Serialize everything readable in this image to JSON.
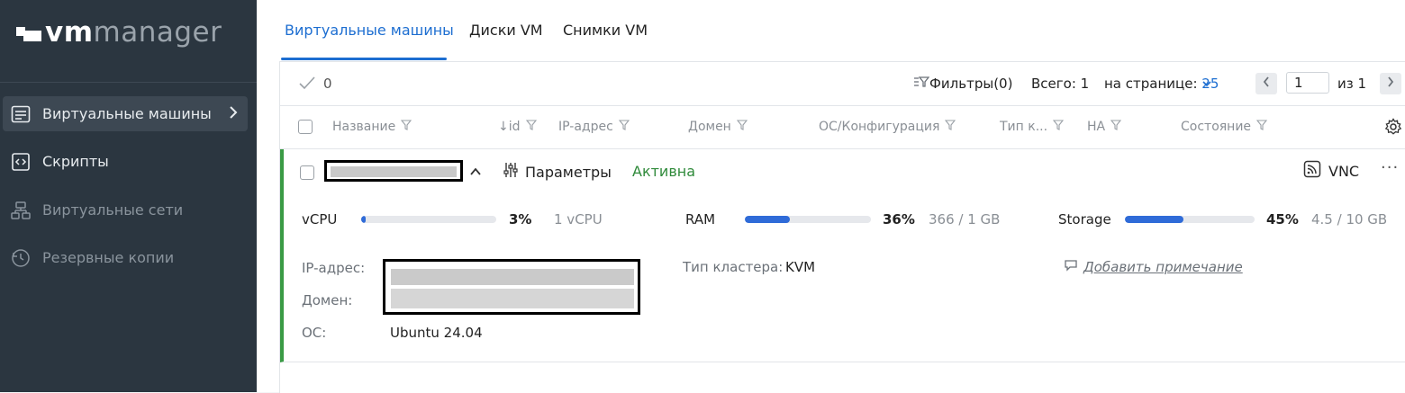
{
  "brand": {
    "vm": "vm",
    "manager": "manager"
  },
  "sidebar": {
    "items": [
      {
        "label": "Виртуальные машины",
        "icon": "vm-list-icon",
        "active": true
      },
      {
        "label": "Скрипты",
        "icon": "script-icon"
      },
      {
        "label": "Виртуальные сети",
        "icon": "network-icon"
      },
      {
        "label": "Резервные копии",
        "icon": "backup-icon"
      }
    ]
  },
  "tabs": [
    {
      "label": "Виртуальные машины"
    },
    {
      "label": "Диски VM"
    },
    {
      "label": "Снимки VM"
    }
  ],
  "toolbar": {
    "selected_count": "0",
    "filters": "Фильтры(0)",
    "total": "Всего: 1",
    "per_page_label": "на странице:",
    "per_page_value": "25",
    "page": "1",
    "of": "из 1"
  },
  "columns": [
    {
      "label": "Название"
    },
    {
      "label": "id",
      "prefix": "↓"
    },
    {
      "label": "IP-адрес"
    },
    {
      "label": "Домен"
    },
    {
      "label": "ОС/Конфигурация"
    },
    {
      "label": "Тип к..."
    },
    {
      "label": "HA"
    },
    {
      "label": "Состояние"
    }
  ],
  "vm": {
    "params_label": "Параметры",
    "status": "Активна",
    "vnc_label": "VNC",
    "metrics": {
      "vcpu": {
        "label": "vCPU",
        "percent": 3,
        "percent_text": "3%",
        "amount": "1 vCPU"
      },
      "ram": {
        "label": "RAM",
        "percent": 36,
        "percent_text": "36%",
        "amount": "366 / 1 GB"
      },
      "storage": {
        "label": "Storage",
        "percent": 45,
        "percent_text": "45%",
        "amount": "4.5 / 10 GB"
      }
    },
    "details": {
      "ip_label": "IP-адрес:",
      "domain_label": "Домен:",
      "os_label": "ОС:",
      "os_value": "Ubuntu 24.04",
      "cluster_label": "Тип кластера:",
      "cluster_value": "KVM",
      "add_note": "Добавить примечание"
    }
  },
  "colors": {
    "accent": "#1d6ed1",
    "active": "#2f8a3a",
    "sidebar": "#2b3640",
    "bar": "#2f6bd8"
  }
}
